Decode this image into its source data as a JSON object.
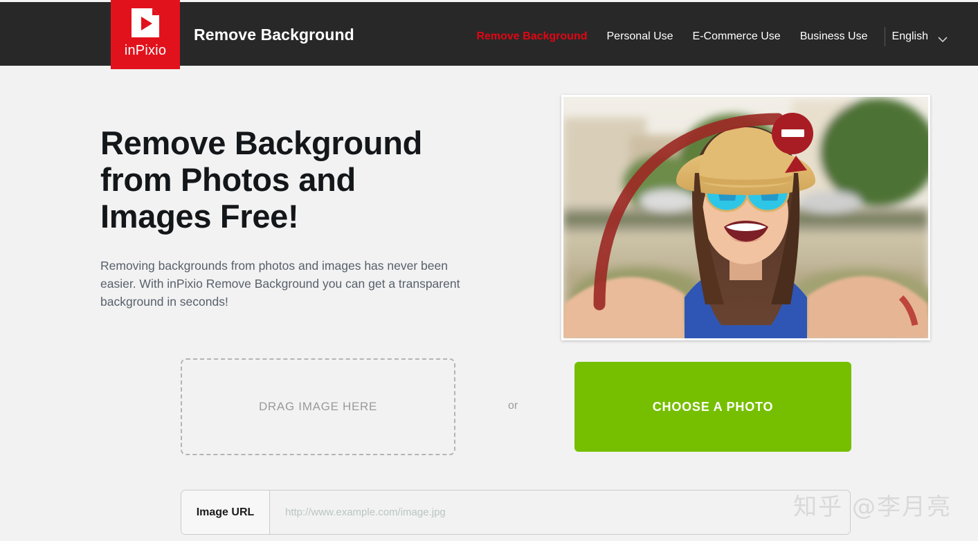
{
  "header": {
    "logo": {
      "icon": "inpixio-play-document-icon",
      "text": "inPixio",
      "color": "#e1121c"
    },
    "brand_title": "Remove Background",
    "nav": [
      {
        "label": "Remove Background",
        "active": true
      },
      {
        "label": "Personal Use",
        "active": false
      },
      {
        "label": "E-Commerce Use",
        "active": false
      },
      {
        "label": "Business Use",
        "active": false
      }
    ],
    "language": {
      "label": "English",
      "icon": "chevron-down-icon"
    },
    "bg_color": "#282828",
    "active_color": "#e30613"
  },
  "hero": {
    "title_lines": [
      "Remove Background",
      "from Photos and",
      "Images Free!"
    ],
    "title": "Remove Background from Photos and Images Free!",
    "description": "Removing backgrounds from photos and images has never been easier. With inPixio Remove Background you can get a transparent background in seconds!",
    "photo": {
      "alt": "Smiling woman in straw hat and blue mirrored sunglasses taking a selfie outdoors",
      "badge_icon": "minus-badge-icon",
      "badge_color": "#a81d23"
    }
  },
  "upload": {
    "dropzone_label": "DRAG IMAGE HERE",
    "or_label": "or",
    "choose_button_label": "CHOOSE A PHOTO",
    "choose_button_color": "#76bf00"
  },
  "url_field": {
    "label": "Image URL",
    "placeholder": "http://www.example.com/image.jpg",
    "value": ""
  },
  "watermark": {
    "text": "知乎 @李月亮"
  }
}
